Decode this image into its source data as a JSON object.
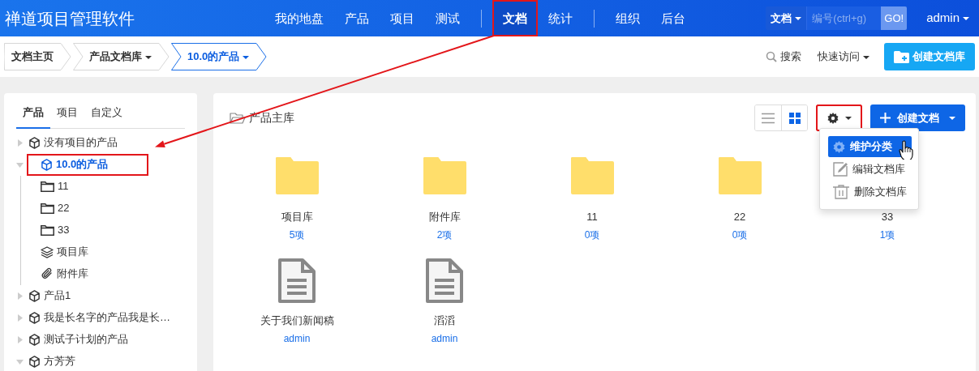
{
  "app_title": "禅道项目管理软件",
  "nav_groups": [
    [
      {
        "label": "我的地盘",
        "selected": false,
        "highlighted": false
      },
      {
        "label": "产品",
        "selected": false,
        "highlighted": false
      },
      {
        "label": "项目",
        "selected": false,
        "highlighted": false
      },
      {
        "label": "测试",
        "selected": false,
        "highlighted": false
      }
    ],
    [
      {
        "label": "文档",
        "selected": true,
        "highlighted": true
      },
      {
        "label": "统计",
        "selected": false,
        "highlighted": false
      }
    ],
    [
      {
        "label": "组织",
        "selected": false,
        "highlighted": false
      },
      {
        "label": "后台",
        "selected": false,
        "highlighted": false
      }
    ]
  ],
  "search": {
    "scope": "文档",
    "placeholder": "编号(ctrl+g)",
    "button": "GO!"
  },
  "user": "admin",
  "breadcrumb": [
    {
      "label": "文档主页",
      "dropdown": false,
      "selected": false
    },
    {
      "label": "产品文档库",
      "dropdown": true,
      "selected": false
    },
    {
      "label": "10.0的产品",
      "dropdown": true,
      "selected": true
    }
  ],
  "toolbar": {
    "search": "搜索",
    "quick_access": "快速访问",
    "create_library": "创建文档库"
  },
  "sidebar": {
    "tabs": [
      {
        "label": "产品",
        "selected": true
      },
      {
        "label": "项目",
        "selected": false
      },
      {
        "label": "自定义",
        "selected": false
      }
    ],
    "tree": [
      {
        "label": "没有项目的产品",
        "kind": "product",
        "expanded": false,
        "selected": false,
        "highlighted": false
      },
      {
        "label": "10.0的产品",
        "kind": "product",
        "expanded": true,
        "selected": true,
        "highlighted": true,
        "children": [
          {
            "label": "11",
            "kind": "folder"
          },
          {
            "label": "22",
            "kind": "folder"
          },
          {
            "label": "33",
            "kind": "folder"
          },
          {
            "label": "项目库",
            "kind": "layers"
          },
          {
            "label": "附件库",
            "kind": "attachment"
          }
        ]
      },
      {
        "label": "产品1",
        "kind": "product",
        "expanded": false,
        "selected": false,
        "highlighted": false
      },
      {
        "label": "我是长名字的产品我是长…",
        "kind": "product",
        "expanded": false,
        "selected": false,
        "highlighted": false
      },
      {
        "label": "测试子计划的产品",
        "kind": "product",
        "expanded": false,
        "selected": false,
        "highlighted": false
      },
      {
        "label": "方芳芳",
        "kind": "product",
        "expanded": true,
        "selected": false,
        "highlighted": false
      }
    ]
  },
  "library": {
    "title": "产品主库",
    "views": [
      {
        "kind": "list",
        "selected": false
      },
      {
        "kind": "grid",
        "selected": true
      }
    ],
    "settings_button": {
      "highlighted": true
    },
    "create_button": "创建文档",
    "menu": [
      {
        "kind": "gear",
        "label": "维护分类",
        "selected": true
      },
      {
        "kind": "edit",
        "label": "编辑文档库",
        "selected": false
      },
      {
        "kind": "trash",
        "label": "删除文档库",
        "selected": false
      }
    ],
    "items": [
      {
        "kind": "folder",
        "name": "项目库",
        "meta": "5项"
      },
      {
        "kind": "folder",
        "name": "附件库",
        "meta": "2项"
      },
      {
        "kind": "folder",
        "name": "11",
        "meta": "0项"
      },
      {
        "kind": "folder",
        "name": "22",
        "meta": "0项"
      },
      {
        "kind": "folder",
        "name": "33",
        "meta": "1项",
        "icon_visible": false
      },
      {
        "kind": "doc",
        "name": "关于我们新闻稿",
        "meta": "admin"
      },
      {
        "kind": "doc",
        "name": "滔滔",
        "meta": "admin"
      }
    ]
  },
  "callout_arrow": true
}
